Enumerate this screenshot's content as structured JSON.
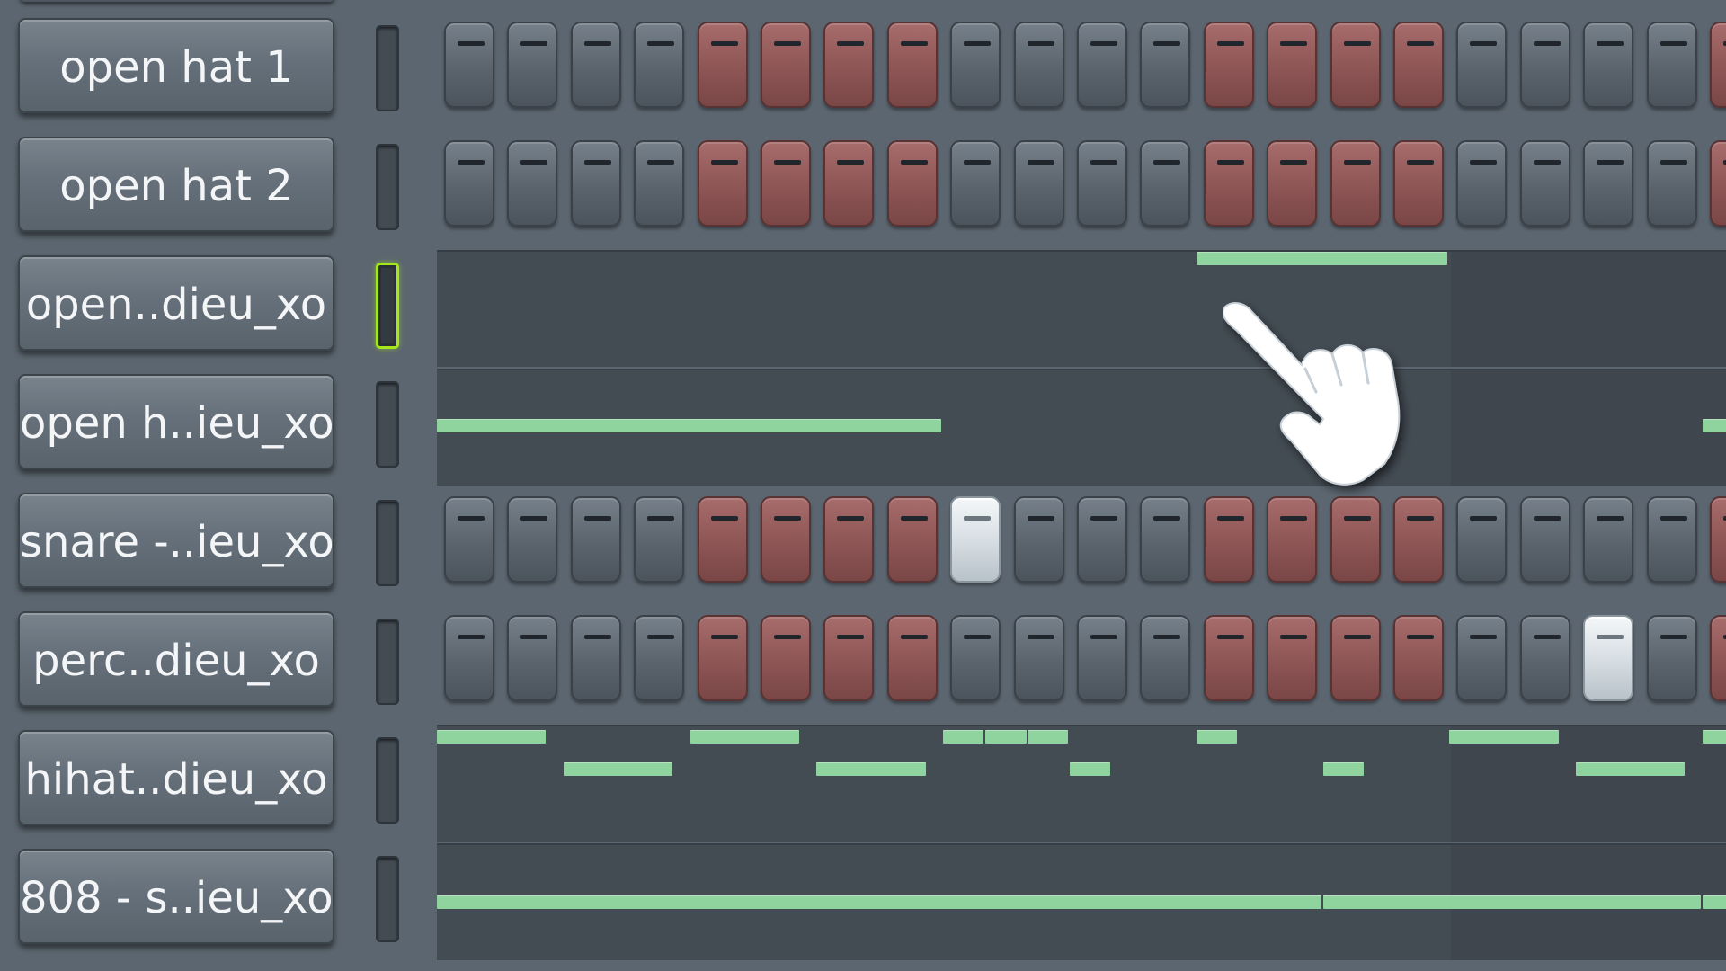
{
  "colors": {
    "background": "#5c6670",
    "step_grey": "#66707a",
    "step_red": "#8e5555",
    "step_lit": "#e4e9ed",
    "note_green": "#8fd39e",
    "selected_led": "#a4e81c"
  },
  "channels": [
    {
      "name": "open hat 1",
      "selected": false,
      "type": "steps",
      "steps": [
        "g",
        "g",
        "g",
        "g",
        "r",
        "r",
        "r",
        "r",
        "g",
        "g",
        "g",
        "g",
        "r",
        "r",
        "r",
        "r",
        "g",
        "g",
        "g",
        "g",
        "r"
      ]
    },
    {
      "name": "open hat 2",
      "selected": false,
      "type": "steps",
      "steps": [
        "g",
        "g",
        "g",
        "g",
        "r",
        "r",
        "r",
        "r",
        "g",
        "g",
        "g",
        "g",
        "r",
        "r",
        "r",
        "r",
        "g",
        "g",
        "g",
        "g",
        "r"
      ]
    },
    {
      "name": "open..dieu_xo",
      "selected": true,
      "type": "notes",
      "notes": [
        {
          "start": 12,
          "length": 4,
          "pitch_row": 0
        }
      ]
    },
    {
      "name": "open h..ieu_xo",
      "selected": false,
      "type": "notes",
      "notes": [
        {
          "start": 0,
          "length": 8,
          "pitch_row": 1
        },
        {
          "start": 20,
          "length": 1,
          "pitch_row": 1
        }
      ]
    },
    {
      "name": "snare -..ieu_xo",
      "selected": false,
      "type": "steps",
      "steps": [
        "g",
        "g",
        "g",
        "g",
        "r",
        "r",
        "r",
        "r",
        "on",
        "g",
        "g",
        "g",
        "r",
        "r",
        "r",
        "r",
        "g",
        "g",
        "g",
        "g",
        "r"
      ]
    },
    {
      "name": "perc..dieu_xo",
      "selected": false,
      "type": "steps",
      "steps": [
        "g",
        "g",
        "g",
        "g",
        "r",
        "r",
        "r",
        "r",
        "g",
        "g",
        "g",
        "g",
        "r",
        "r",
        "r",
        "r",
        "g",
        "g",
        "on",
        "g",
        "r"
      ]
    },
    {
      "name": "hihat..dieu_xo",
      "selected": false,
      "type": "notes",
      "notes": [
        {
          "start": 0,
          "length": 1.75,
          "pitch_row": 0
        },
        {
          "start": 2,
          "length": 1.75,
          "pitch_row": 1
        },
        {
          "start": 4,
          "length": 1.75,
          "pitch_row": 0
        },
        {
          "start": 6,
          "length": 1.75,
          "pitch_row": 1
        },
        {
          "start": 8,
          "length": 0.67,
          "pitch_row": 0
        },
        {
          "start": 8.67,
          "length": 0.67,
          "pitch_row": 0
        },
        {
          "start": 9.33,
          "length": 0.67,
          "pitch_row": 0
        },
        {
          "start": 10,
          "length": 0.67,
          "pitch_row": 1
        },
        {
          "start": 12,
          "length": 0.67,
          "pitch_row": 0
        },
        {
          "start": 14,
          "length": 0.67,
          "pitch_row": 1
        },
        {
          "start": 16,
          "length": 1.75,
          "pitch_row": 0
        },
        {
          "start": 18,
          "length": 1.75,
          "pitch_row": 1
        },
        {
          "start": 20,
          "length": 1,
          "pitch_row": 0
        }
      ]
    },
    {
      "name": "808 - s..ieu_xo",
      "selected": false,
      "type": "notes",
      "notes": [
        {
          "start": 0,
          "length": 14,
          "pitch_row": 1
        },
        {
          "start": 14,
          "length": 6,
          "pitch_row": 1
        },
        {
          "start": 20,
          "length": 1,
          "pitch_row": 1
        }
      ]
    }
  ],
  "cursor_icon": "pointing-hand-icon"
}
